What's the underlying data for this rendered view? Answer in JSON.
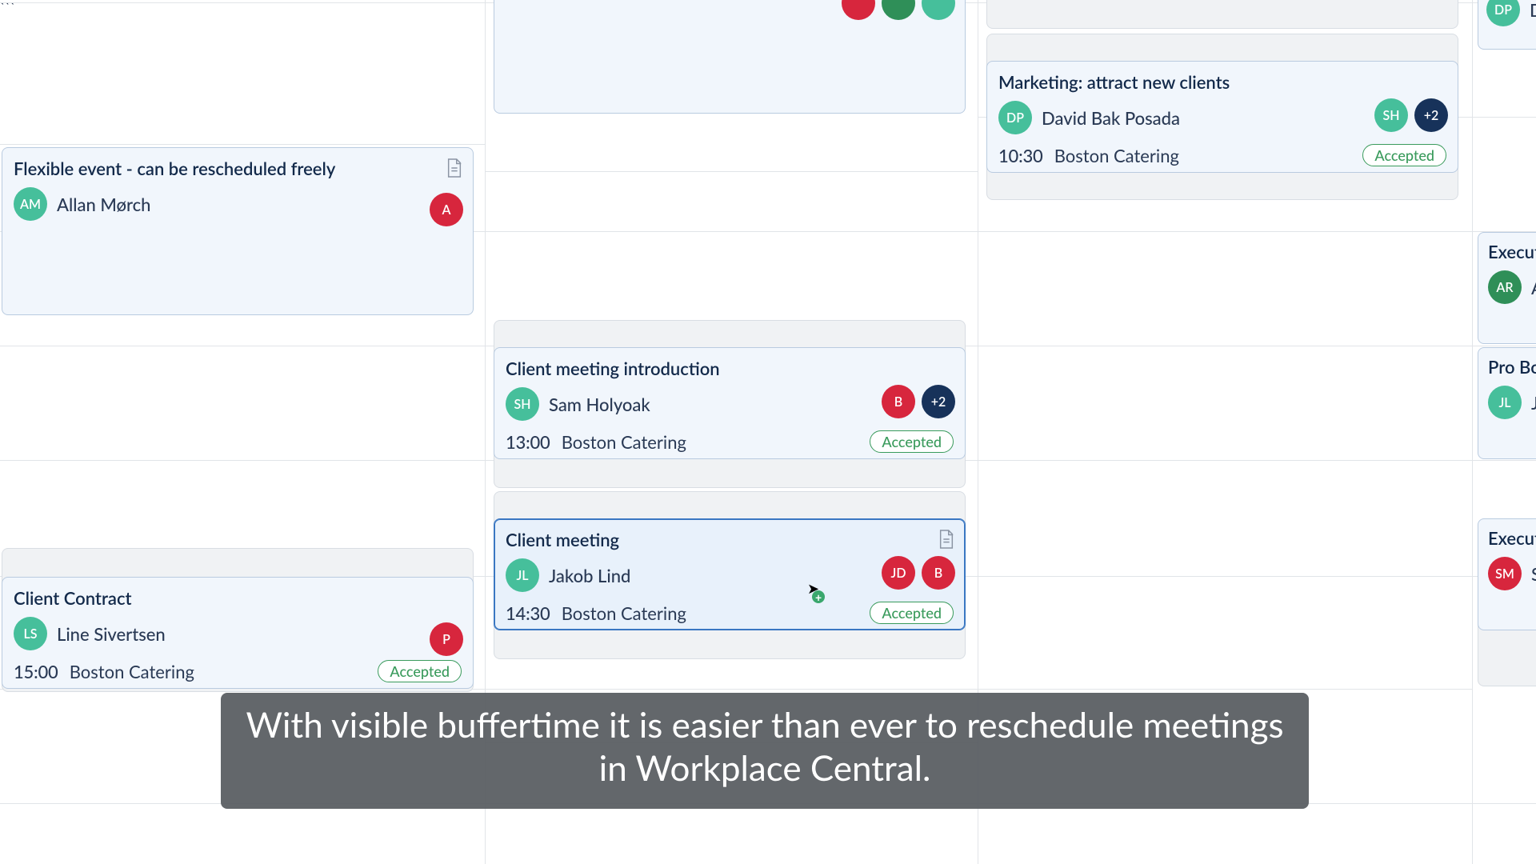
{
  "colors": {
    "teal": "#46bf9b",
    "red": "#d7263d",
    "navy": "#17325a",
    "green": "#2f8f58",
    "accepted": "#3a9b5c"
  },
  "caption": "With visible buffertime it is easier than ever to reschedule meetings in Workplace Central.",
  "col0": {
    "flexible": {
      "title": "Flexible event - can be rescheduled freely",
      "organizer_initials": "AM",
      "organizer_name": "Allan Mørch",
      "right_avatar": "A"
    },
    "contract": {
      "title": "Client Contract",
      "organizer_initials": "LS",
      "organizer_name": "Line Sivertsen",
      "right_avatar": "P",
      "time": "15:00",
      "location": "Boston Catering",
      "status": "Accepted"
    }
  },
  "col1": {
    "intro": {
      "title": "Client meeting introduction",
      "organizer_initials": "SH",
      "organizer_name": "Sam Holyoak",
      "avatars": [
        "B",
        "+2"
      ],
      "time": "13:00",
      "location": "Boston Catering",
      "status": "Accepted"
    },
    "client": {
      "title": "Client meeting",
      "organizer_initials": "JL",
      "organizer_name": "Jakob Lind",
      "avatars": [
        "JD",
        "B"
      ],
      "time": "14:30",
      "location": "Boston Catering",
      "status": "Accepted"
    }
  },
  "col2": {
    "marketing": {
      "title": "Marketing: attract new clients",
      "organizer_initials": "DP",
      "organizer_name": "David Bak Posada",
      "avatars": [
        "SH",
        "+2"
      ],
      "time": "10:30",
      "location": "Boston Catering",
      "status": "Accepted"
    }
  },
  "col3": {
    "peek0": {
      "initials": "DP",
      "name_partial": "D"
    },
    "peek1": {
      "title": "Executi",
      "initials": "AR",
      "name_partial": "A"
    },
    "peek2": {
      "title": "Pro Bon",
      "initials": "JL",
      "name_partial": "Ja"
    },
    "peek3": {
      "title": "Executi",
      "initials": "SM",
      "name_partial": "S"
    }
  }
}
